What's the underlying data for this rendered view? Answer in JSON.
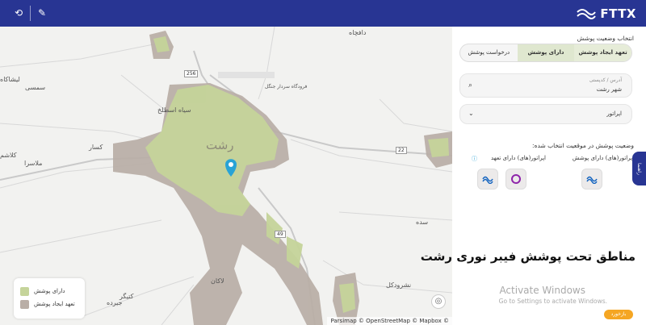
{
  "topbar": {
    "logo_text": "FTTX",
    "icons": [
      "sync-icon",
      "edit-icon"
    ]
  },
  "panel": {
    "section_title": "انتخاب وضعیت پوشش",
    "tabs": [
      {
        "label": "تعهد ایجاد پوشش"
      },
      {
        "label": "دارای پوشش"
      },
      {
        "label": "درخواست پوشش"
      }
    ],
    "address": {
      "label": "آدرس / کدپستی",
      "value": "شهر رشت"
    },
    "operator": {
      "label": "اپراتور"
    },
    "status_title": "وضعیت پوشش در موقعیت انتخاب شده:",
    "covered_heading": "اپراتور(های) دارای پوشش",
    "committed_heading": "اپراتور(های) دارای تعهد",
    "headline": "مناطق تحت پوشش فیبر نوری رشت",
    "feedback": "بازخورد",
    "side_tab": "راهنما"
  },
  "watermark": {
    "line1": "Activate Windows",
    "line2": "Go to Settings to activate Windows."
  },
  "map": {
    "city_label": "رشت",
    "labels": [
      {
        "text": "دافچاه"
      },
      {
        "text": "لیشاکاه"
      },
      {
        "text": "سمسی"
      },
      {
        "text": "سیاه اسطلخ"
      },
      {
        "text": "کسار"
      },
      {
        "text": "ملاسرا"
      },
      {
        "text": "کلاشم"
      },
      {
        "text": "سده"
      },
      {
        "text": "لاکان"
      },
      {
        "text": "نشرودکل"
      },
      {
        "text": "کتیگر"
      },
      {
        "text": "جیرده"
      },
      {
        "text": "فرودگاه سردار جنگل"
      }
    ],
    "shields": [
      "256",
      "22",
      "49"
    ],
    "legend": [
      {
        "label": "دارای پوشش",
        "color": "#c5d49a"
      },
      {
        "label": "تعهد ایجاد پوشش",
        "color": "#b9aea6"
      }
    ],
    "attribution": "Parsimap © OpenStreetMap © Mapbox ©",
    "colors": {
      "covered": "#c5d49a",
      "committed": "#b9aea6",
      "pin": "#29a3d6"
    }
  }
}
